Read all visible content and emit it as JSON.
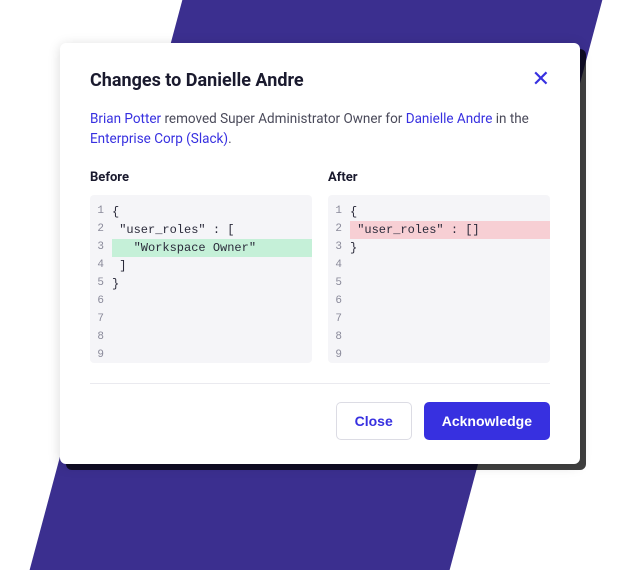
{
  "modal": {
    "title": "Changes to Danielle Andre",
    "description": {
      "actor": "Brian Potter",
      "text1": " removed Super Administrator Owner for ",
      "subject": "Danielle Andre",
      "text2": " in the ",
      "workspace": "Enterprise Corp (Slack)",
      "text3": "."
    },
    "before": {
      "label": "Before",
      "lines": [
        {
          "num": "1",
          "content": "{",
          "highlight": null
        },
        {
          "num": "2",
          "content": " \"user_roles\" : [",
          "highlight": null
        },
        {
          "num": "3",
          "content": "   \"Workspace Owner\"",
          "highlight": "added"
        },
        {
          "num": "4",
          "content": " ]",
          "highlight": null
        },
        {
          "num": "5",
          "content": "}",
          "highlight": null
        },
        {
          "num": "6",
          "content": "",
          "highlight": null
        },
        {
          "num": "7",
          "content": "",
          "highlight": null
        },
        {
          "num": "8",
          "content": "",
          "highlight": null
        },
        {
          "num": "9",
          "content": "",
          "highlight": null
        }
      ]
    },
    "after": {
      "label": "After",
      "lines": [
        {
          "num": "1",
          "content": "{",
          "highlight": null
        },
        {
          "num": "2",
          "content": " \"user_roles\" : []",
          "highlight": "removed"
        },
        {
          "num": "3",
          "content": "}",
          "highlight": null
        },
        {
          "num": "4",
          "content": "",
          "highlight": null
        },
        {
          "num": "5",
          "content": "",
          "highlight": null
        },
        {
          "num": "6",
          "content": "",
          "highlight": null
        },
        {
          "num": "7",
          "content": "",
          "highlight": null
        },
        {
          "num": "8",
          "content": "",
          "highlight": null
        },
        {
          "num": "9",
          "content": "",
          "highlight": null
        }
      ]
    },
    "buttons": {
      "close": "Close",
      "acknowledge": "Acknowledge"
    }
  }
}
